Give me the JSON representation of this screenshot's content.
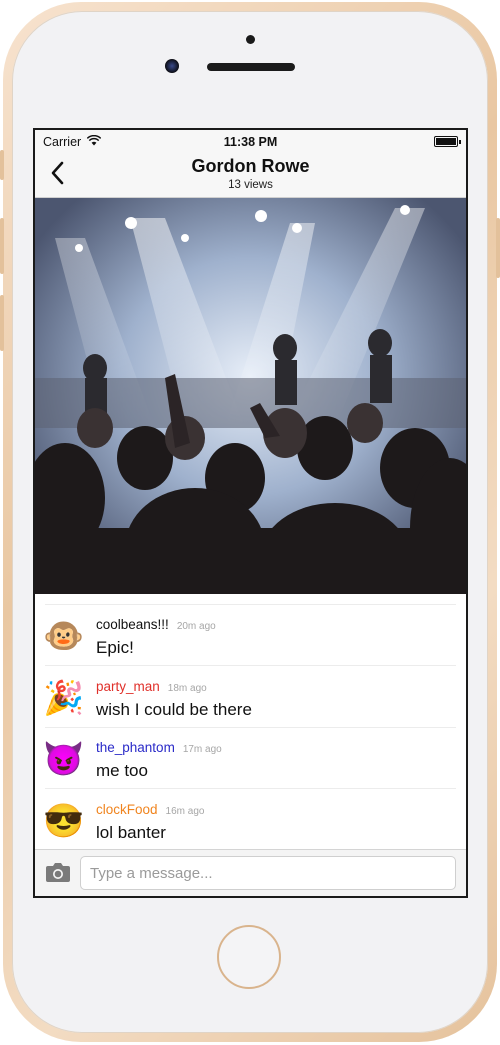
{
  "status_bar": {
    "carrier": "Carrier",
    "time": "11:38 PM"
  },
  "nav": {
    "title": "Gordon Rowe",
    "subtitle": "13 views"
  },
  "messages": [
    {
      "username": "coolbeans!!!",
      "time_ago": "20m ago",
      "text": "Epic!",
      "avatar": "🐵",
      "name_color": "#111111"
    },
    {
      "username": "party_man",
      "time_ago": "18m ago",
      "text": "wish I could be there",
      "avatar": "🎉",
      "name_color": "#e0302a"
    },
    {
      "username": "the_phantom",
      "time_ago": "17m ago",
      "text": "me too",
      "avatar": "😈",
      "name_color": "#2a2ac8"
    },
    {
      "username": "clockFood",
      "time_ago": "16m ago",
      "text": "lol banter",
      "avatar": "😎",
      "name_color": "#f0841e"
    }
  ],
  "composer": {
    "placeholder": "Type a message..."
  }
}
